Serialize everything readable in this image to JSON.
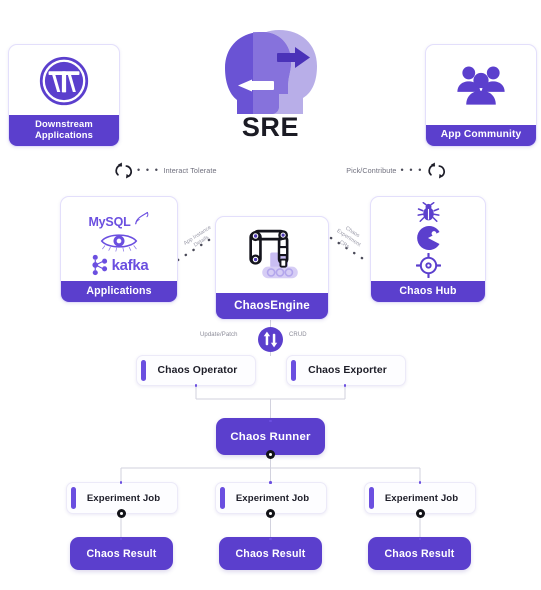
{
  "diagram": {
    "title": "SRE",
    "center_icon": "two-heads-exchange-icon"
  },
  "top_row": {
    "left_card": {
      "label": "Downstream\nApplications",
      "label_line1": "Downstream",
      "label_line2": "Applications",
      "icon": "wordpress-logo-icon"
    },
    "right_card": {
      "label": "App Community",
      "icon": "user-group-icon"
    }
  },
  "flow_labels": {
    "interact_tolerate": "Interact Tolerate",
    "pick_contribute": "Pick/Contribute",
    "app_instance_details_line1": "App Instance",
    "app_instance_details_line2": "Details",
    "chaos_experiment_line1": "Chaos",
    "chaos_experiment_line2": "Experiment",
    "chaos_experiment_line3": "CRs",
    "update_patch": "Update/Patch",
    "crud": "CRUD",
    "dots": "• • •"
  },
  "middle_row": {
    "applications": {
      "label": "Applications",
      "icons": [
        "mysql-logo-icon",
        "openebs-eye-icon",
        "kafka-logo-icon"
      ],
      "icon_texts": [
        "MySQL",
        "kafka"
      ]
    },
    "chaos_engine": {
      "label": "ChaosEngine",
      "icon": "robotic-arm-conveyor-icon"
    },
    "chaos_hub": {
      "label": "Chaos Hub",
      "icons": [
        "bug-icon",
        "pacman-icon",
        "crosshair-target-icon"
      ]
    }
  },
  "controllers": {
    "chaos_operator": "Chaos Operator",
    "chaos_exporter": "Chaos Exporter",
    "sync_icon": "up-down-arrows-icon"
  },
  "runner": {
    "label": "Chaos Runner"
  },
  "jobs": [
    {
      "job_label": "Experiment Job",
      "result_label": "Chaos Result"
    },
    {
      "job_label": "Experiment Job",
      "result_label": "Chaos Result"
    },
    {
      "job_label": "Experiment Job",
      "result_label": "Chaos Result"
    }
  ],
  "colors": {
    "primary_purple": "#5b3fcd",
    "accent_purple": "#6b4fe0",
    "light_purple": "#b3a6ec",
    "dark_head": "#6a53d4",
    "light_head": "#b8aee8",
    "line_gray": "#d2d2de",
    "text_dark": "#1d1d28",
    "label_gray": "#6f6f7d",
    "background": "#ffffff"
  }
}
